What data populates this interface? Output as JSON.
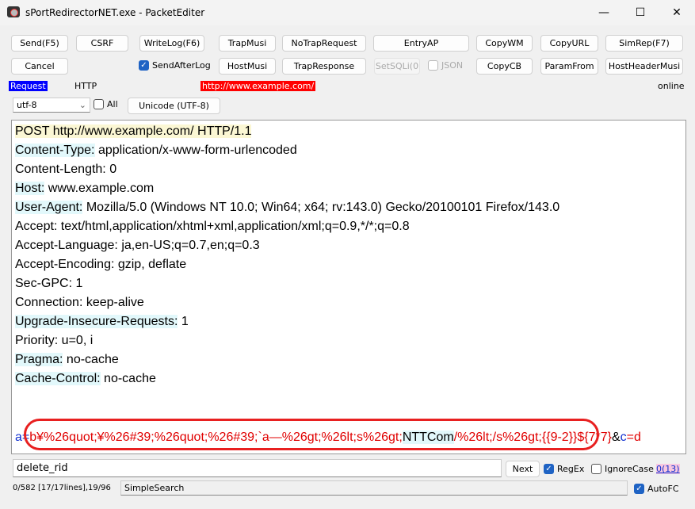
{
  "window": {
    "title": "sPortRedirectorNET.exe - PacketEditer",
    "minimize": "—",
    "maximize": "☐",
    "close": "✕"
  },
  "toolbar": {
    "row1": [
      "Send(F5)",
      "CSRF",
      "WriteLog(F6)",
      "TrapMusi",
      "NoTrapRequest",
      "EntryAP",
      "CopyWM",
      "CopyURL",
      "SimRep(F7)"
    ],
    "row2": {
      "cancel": "Cancel",
      "send_after_log": "SendAfterLog",
      "host_musi": "HostMusi",
      "trap_response": "TrapResponse",
      "set_sqli": "SetSQLi(0",
      "json": "JSON",
      "copy_cb": "CopyCB",
      "param_from": "ParamFrom",
      "host_header_musi": "HostHeaderMusi"
    }
  },
  "info": {
    "mode": "Request",
    "protocol": "HTTP",
    "url": "http://www.example.com/",
    "status": "online"
  },
  "encoding": {
    "selected": "utf-8",
    "all_label": "All",
    "unicode_button": "Unicode (UTF-8)"
  },
  "editor": {
    "lines": [
      {
        "key": "POST http://www.example.com/ HTTP/1.1",
        "value": ""
      },
      {
        "key": "Content-Type:",
        "value": " application/x-www-form-urlencoded"
      },
      {
        "key": "",
        "value": "Content-Length: 0"
      },
      {
        "key": "Host:",
        "value": " www.example.com"
      },
      {
        "key": "User-Agent:",
        "value": " Mozilla/5.0 (Windows NT 10.0; Win64; x64; rv:143.0) Gecko/20100101 Firefox/143.0"
      },
      {
        "key": "",
        "value": "Accept: text/html,application/xhtml+xml,application/xml;q=0.9,*/*;q=0.8"
      },
      {
        "key": "",
        "value": "Accept-Language: ja,en-US;q=0.7,en;q=0.3"
      },
      {
        "key": "",
        "value": "Accept-Encoding: gzip, deflate"
      },
      {
        "key": "",
        "value": "Sec-GPC: 1"
      },
      {
        "key": "",
        "value": "Connection: keep-alive"
      },
      {
        "key": "Upgrade-Insecure-Requests:",
        "value": " 1"
      },
      {
        "key": "",
        "value": "Priority: u=0, i"
      },
      {
        "key": "Pragma:",
        "value": " no-cache"
      },
      {
        "key": "Cache-Control:",
        "value": " no-cache"
      }
    ],
    "body": {
      "p1": "a",
      "p2": "=",
      "p3": "b¥%26quot;¥%26#39;%26quot;%26#39;`a—%26gt;%26lt;s%26gt;",
      "p4": "NTTCom",
      "p5": "/%26lt;/s%26gt;{{9-2}}${7*7}",
      "p6": "&",
      "p7": "c",
      "p8": "=d"
    }
  },
  "search": {
    "value": "delete_rid",
    "next": "Next",
    "regex": "RegEx",
    "ignore_case": "IgnoreCase",
    "count": "0(13)"
  },
  "statusbar": {
    "position": "0/582 [17/17lines],19/96",
    "mode": "SimpleSearch",
    "autofc": "AutoFC"
  }
}
